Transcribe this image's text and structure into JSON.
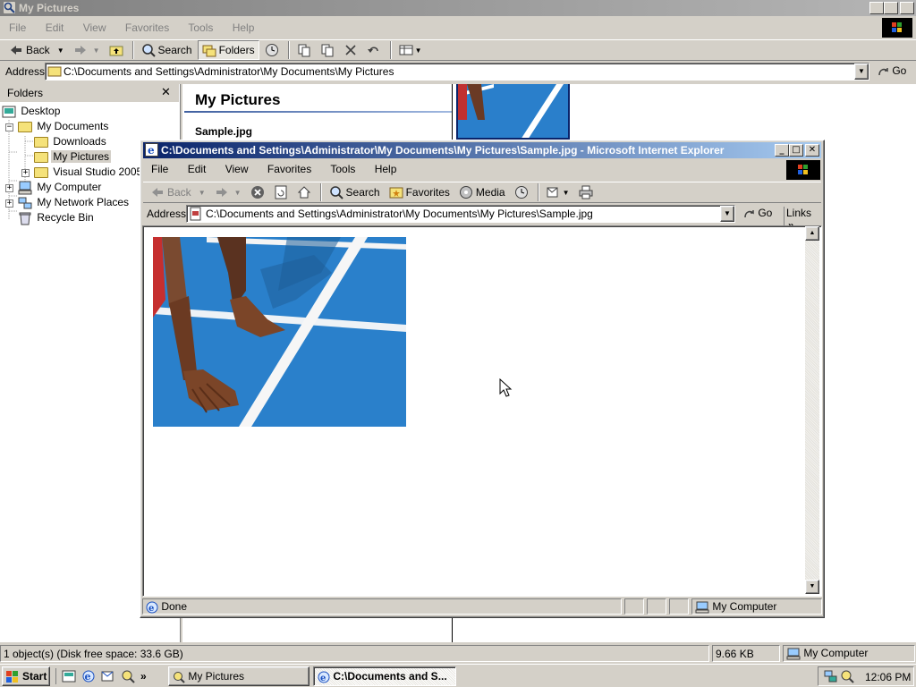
{
  "explorer": {
    "title": "My Pictures",
    "menu": [
      "File",
      "Edit",
      "View",
      "Favorites",
      "Tools",
      "Help"
    ],
    "toolbar": {
      "back": "Back",
      "search": "Search",
      "folders": "Folders"
    },
    "address_label": "Address",
    "address_value": "C:\\Documents and Settings\\Administrator\\My Documents\\My Pictures",
    "go": "Go",
    "folders_pane_title": "Folders",
    "tree": [
      "Desktop",
      "My Documents",
      "Downloads",
      "My Pictures",
      "Visual Studio 2005",
      "My Computer",
      "My Network Places",
      "Recycle Bin"
    ],
    "content_heading": "My Pictures",
    "selected_file": "Sample.jpg",
    "status_left": "1 object(s) (Disk free space: 33.6 GB)",
    "status_size": "9.66 KB",
    "status_zone": "My Computer"
  },
  "ie": {
    "title": "C:\\Documents and Settings\\Administrator\\My Documents\\My Pictures\\Sample.jpg - Microsoft Internet Explorer",
    "menu": [
      "File",
      "Edit",
      "View",
      "Favorites",
      "Tools",
      "Help"
    ],
    "toolbar": {
      "back": "Back",
      "search": "Search",
      "favorites": "Favorites",
      "media": "Media"
    },
    "address_label": "Address",
    "address_value": "C:\\Documents and Settings\\Administrator\\My Documents\\My Pictures\\Sample.jpg",
    "go": "Go",
    "links": "Links",
    "status_text": "Done",
    "status_zone": "My Computer"
  },
  "taskbar": {
    "start": "Start",
    "tasks": [
      "My Pictures",
      "C:\\Documents and S..."
    ],
    "clock": "12:06 PM"
  }
}
